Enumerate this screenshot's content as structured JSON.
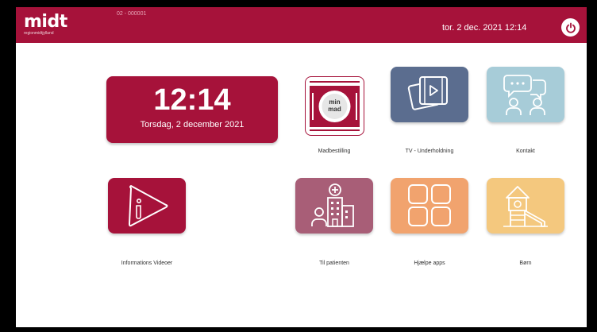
{
  "header": {
    "logo_main": "midt",
    "logo_sub": "regionmidtjylland",
    "device_id": "02 - 000001",
    "datetime": "tor. 2 dec. 2021 12:14"
  },
  "clock": {
    "time": "12:14",
    "date": "Torsdag, 2 december 2021"
  },
  "tiles": [
    {
      "label": "Madbestilling",
      "icon": "min-mad-icon",
      "icon_text_1": "min",
      "icon_text_2": "mad",
      "color": "#ffffff"
    },
    {
      "label": "TV - Underholdning",
      "icon": "video-play-icon",
      "color": "#5b6d8f"
    },
    {
      "label": "Kontakt",
      "icon": "chat-people-icon",
      "color": "#a7ccd8"
    },
    {
      "label": "Informations Videoer",
      "icon": "info-play-icon",
      "color": "#a6123a"
    },
    {
      "label": "Til patienten",
      "icon": "hospital-icon",
      "color": "#a85e77"
    },
    {
      "label": "Hjælpe apps",
      "icon": "apps-grid-icon",
      "color": "#f1a36e"
    },
    {
      "label": "Børn",
      "icon": "playground-icon",
      "color": "#f4c87e"
    }
  ],
  "colors": {
    "brand": "#a6123a",
    "background": "#ffffff"
  }
}
